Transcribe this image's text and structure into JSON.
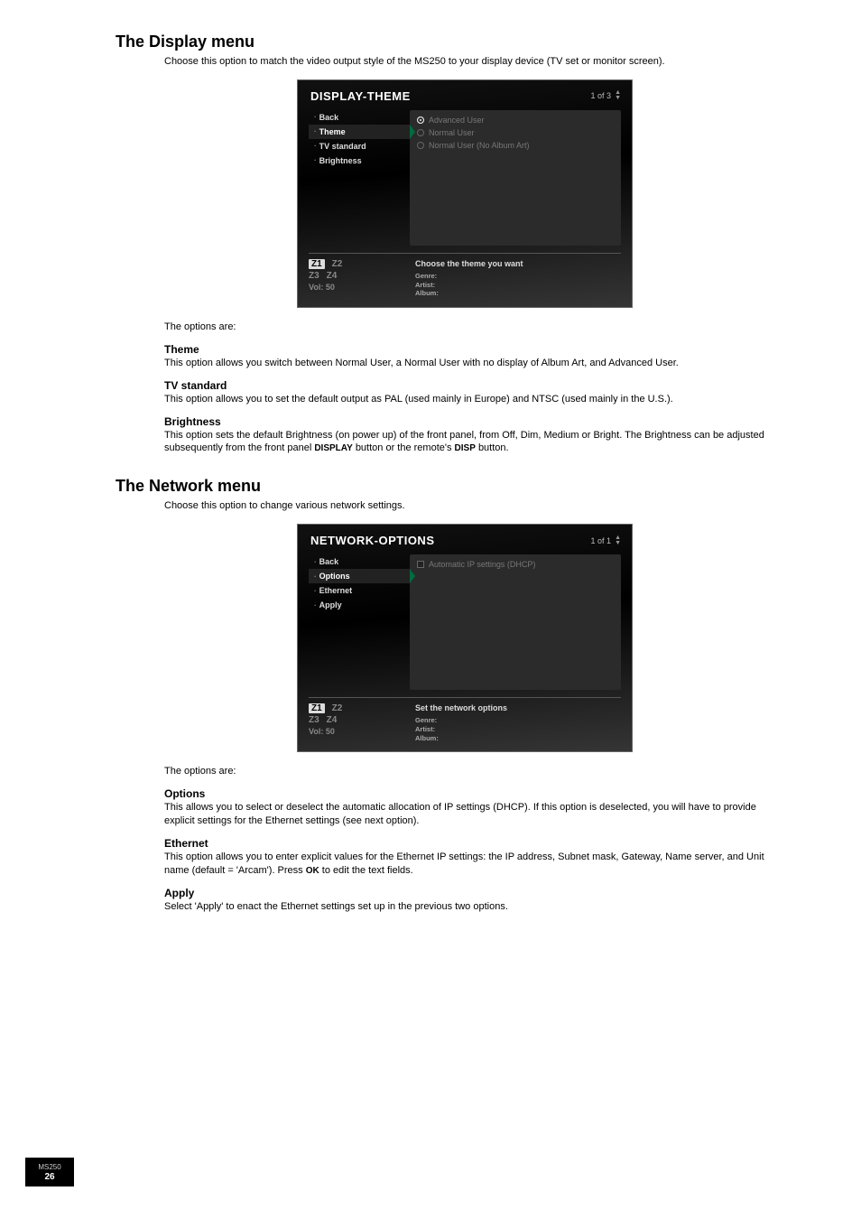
{
  "section1": {
    "title": "The Display menu",
    "intro": "Choose this option to match the video output style of the MS250 to your display device (TV set or monitor screen).",
    "options_intro": "The options are:",
    "theme": {
      "title": "Theme",
      "body": "This option allows you switch between Normal User, a Normal User with no display of Album Art, and Advanced User."
    },
    "tvstd": {
      "title": "TV standard",
      "body": "This option allows you to set the default output as PAL (used mainly in Europe) and NTSC (used mainly in the U.S.)."
    },
    "brightness": {
      "title": "Brightness",
      "body_pre": "This option sets the default Brightness (on power up) of the front panel, from Off, Dim, Medium or Bright. The Brightness can be adjusted subsequently from the front panel ",
      "body_mid": " button or the remote's ",
      "body_post": " button.",
      "DISPLAY": "DISPLAY",
      "DISP": "DISP"
    },
    "shot": {
      "title": "DISPLAY-THEME",
      "counter": "1 of 3",
      "menu": [
        "Back",
        "Theme",
        "TV standard",
        "Brightness"
      ],
      "selected_index": 1,
      "options": [
        "Advanced User",
        "Normal User",
        "Normal User (No Album Art)"
      ],
      "hint": "Choose the theme you want",
      "meta": {
        "genre": "Genre:",
        "artist": "Artist:",
        "album": "Album:"
      },
      "zones": {
        "z1": "Z1",
        "z2": "Z2",
        "z3": "Z3",
        "z4": "Z4",
        "vol": "Vol:   50"
      }
    }
  },
  "section2": {
    "title": "The Network menu",
    "intro": "Choose this option to change various network settings.",
    "options_intro": "The options are:",
    "options": {
      "title": "Options",
      "body": "This allows you to select or deselect the automatic allocation of IP settings (DHCP). If this option is deselected, you will have to provide explicit settings for the Ethernet settings (see next option)."
    },
    "ethernet": {
      "title": "Ethernet",
      "body_pre": "This option allows you to enter explicit values for the Ethernet IP settings: the IP address, Subnet mask, Gateway, Name server, and Unit name (default = 'Arcam'). Press ",
      "OK": "OK",
      "body_post": " to edit the text fields."
    },
    "apply": {
      "title": "Apply",
      "body": "Select 'Apply' to enact the Ethernet settings set up in the previous two options."
    },
    "shot": {
      "title": "NETWORK-OPTIONS",
      "counter": "1 of 1",
      "menu": [
        "Back",
        "Options",
        "Ethernet",
        "Apply"
      ],
      "selected_index": 1,
      "option_label": "Automatic IP settings (DHCP)",
      "hint": "Set the network options",
      "meta": {
        "genre": "Genre:",
        "artist": "Artist:",
        "album": "Album:"
      },
      "zones": {
        "z1": "Z1",
        "z2": "Z2",
        "z3": "Z3",
        "z4": "Z4",
        "vol": "Vol:   50"
      }
    }
  },
  "badge": {
    "model": "MS250",
    "page": "26"
  }
}
